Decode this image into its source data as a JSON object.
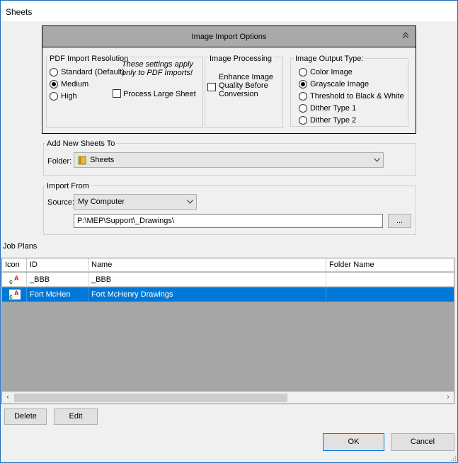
{
  "window": {
    "title": "Sheets"
  },
  "image_import": {
    "header": "Image Import Options",
    "collapse_icon": "double-chevron-up-icon",
    "pdf": {
      "legend": "PDF Import Resolution",
      "note_line1": "These settings apply",
      "note_line2": "only to PDF Imports!",
      "options": [
        "Standard (Default)",
        "Medium",
        "High"
      ],
      "selected": "Medium",
      "process_large_sheet": "Process Large Sheet",
      "process_large_sheet_checked": false
    },
    "processing": {
      "legend": "Image Processing",
      "line1": "Enhance Image",
      "line2": "Quality Before",
      "line3": "Conversion",
      "checked": false
    },
    "output": {
      "legend": "Image Output Type:",
      "options": [
        "Color Image",
        "Grayscale Image",
        "Threshold to Black & White",
        "Dither Type 1",
        "Dither Type 2"
      ],
      "selected": "Grayscale Image"
    }
  },
  "add_new_sheets": {
    "legend": "Add New Sheets To",
    "folder_label": "Folder:",
    "folder_value": "Sheets",
    "folder_icon": "folder-icon"
  },
  "import_from": {
    "legend": "Import From",
    "source_label": "Source:",
    "source_value": "My Computer",
    "path": "P:\\MEP\\Support\\_Drawings\\",
    "browse_label": "..."
  },
  "job_plans": {
    "label": "Job Plans",
    "columns": [
      "Icon",
      "ID",
      "Name",
      "Folder Name"
    ],
    "rows": [
      {
        "id": "_BBB",
        "name": "_BBB",
        "folder": "",
        "selected": false
      },
      {
        "id": "Fort McHen",
        "name": "Fort McHenry Drawings",
        "folder": "",
        "selected": true
      }
    ]
  },
  "buttons": {
    "delete": "Delete",
    "edit": "Edit",
    "ok": "OK",
    "cancel": "Cancel"
  },
  "colors": {
    "selection": "#0078d7",
    "grid_bg": "#a6a6a6",
    "header_bg": "#a9a9a9"
  }
}
